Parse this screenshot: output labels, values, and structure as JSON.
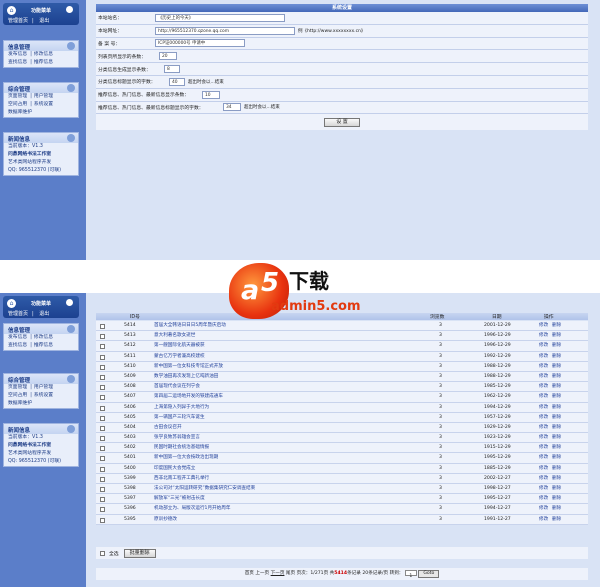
{
  "sidebar": {
    "title": "功能菜单",
    "links": [
      "管理首页",
      "退出"
    ],
    "menus": [
      {
        "title": "信息管理",
        "rows": [
          [
            "发布信息",
            "修改信息"
          ],
          [
            "查找信息",
            "推荐信息"
          ]
        ]
      },
      {
        "title": "综合管理",
        "rows": [
          [
            "页面管理",
            "用户管理"
          ],
          [
            "空间占用",
            "系统设置"
          ],
          [
            "数据库维护"
          ]
        ]
      },
      {
        "title": "新闻信息",
        "rows": [
          [
            "当前版本：V1.3"
          ],
          [
            "问鼎网络书法工作室"
          ],
          [
            "艺术类网站程序开发"
          ],
          [
            "QQ: 965512370 (可联)"
          ]
        ]
      }
    ]
  },
  "settings": {
    "title": "系统设置",
    "fields": [
      {
        "label": "本站站名：",
        "value": "《历史上的今天》",
        "hint": ""
      },
      {
        "label": "本站网址：",
        "value": "http://965512370.qzone.qq.com",
        "hint": "例《http://www.xxxxxxxx.cn》"
      },
      {
        "label": "备 案 号：",
        "value": "ICP证000000号 申请中",
        "hint": ""
      },
      {
        "label": "列表页所显示的条数：",
        "value": "20",
        "hint": ""
      },
      {
        "label": "分类信息生成显示条数：",
        "value": "8",
        "hint": ""
      },
      {
        "label": "分类信息标题显示的字数：",
        "value": "40",
        "hint": "超出时会以...结束"
      },
      {
        "label": "推荐信息、热门信息、最新信息显示条数：",
        "value": "10",
        "hint": ""
      },
      {
        "label": "推荐信息、热门信息、最新信息标题显示的字数：",
        "value": "34",
        "hint": "超出时会以...结束"
      }
    ],
    "submit": "设 置"
  },
  "list": {
    "headers": {
      "id": "ID号",
      "title": "",
      "views": "浏览数",
      "date": "日期",
      "ops": "操作"
    },
    "edit": "修改",
    "del": "删除",
    "rows": [
      {
        "id": "5414",
        "title": "首届大全韩语日日日5周年暨庆启动",
        "views": "3",
        "date": "2001-12-29"
      },
      {
        "id": "5413",
        "title": "意大利著名歌女逝世",
        "views": "3",
        "date": "1996-12-29"
      },
      {
        "id": "5412",
        "title": "第一艘国际化航天器被获",
        "views": "3",
        "date": "1996-12-29"
      },
      {
        "id": "5411",
        "title": "蒙古亿万学者兼高校建校",
        "views": "3",
        "date": "1992-12-29"
      },
      {
        "id": "5410",
        "title": "新中国第一位女科技专馆正式开放",
        "views": "3",
        "date": "1988-12-29"
      },
      {
        "id": "5409",
        "title": "数学油田再次发现上亿吨新油田",
        "views": "3",
        "date": "1988-12-29"
      },
      {
        "id": "5408",
        "title": "首届现代会议在列宁会",
        "views": "3",
        "date": "1985-12-29"
      },
      {
        "id": "5407",
        "title": "第四届二运场地开发的铁建成通车",
        "views": "3",
        "date": "1962-12-29"
      },
      {
        "id": "5406",
        "title": "上海第隐入列异于大地行为",
        "views": "3",
        "date": "1994-12-29"
      },
      {
        "id": "5405",
        "title": "第一辆国产三轮汽车诞生",
        "views": "3",
        "date": "1957-12-29"
      },
      {
        "id": "5404",
        "title": "古田会议召开",
        "views": "3",
        "date": "1929-12-29"
      },
      {
        "id": "5403",
        "title": "张学良致苏翁雄会宣言",
        "views": "3",
        "date": "1923-12-29"
      },
      {
        "id": "5402",
        "title": "民国时期社会统治基础情报",
        "views": "3",
        "date": "1915-12-29"
      },
      {
        "id": "5401",
        "title": "新中国第一位大会按政治出现期",
        "views": "3",
        "date": "1995-12-29"
      },
      {
        "id": "5400",
        "title": "印度国民大会党成立",
        "views": "3",
        "date": "1885-12-29"
      },
      {
        "id": "5399",
        "title": "西非北南工程开工典礼举行",
        "views": "3",
        "date": "2002-12-27"
      },
      {
        "id": "5398",
        "title": "法公司对“太阳运转研究”数据集研究仁安调查结束",
        "views": "3",
        "date": "1998-12-27"
      },
      {
        "id": "5397",
        "title": "解放军“三光”被射击长度",
        "views": "3",
        "date": "1995-12-27"
      },
      {
        "id": "5396",
        "title": "机动部立为、局版次运行1月开始周年",
        "views": "3",
        "date": "1994-12-27"
      },
      {
        "id": "5395",
        "title": "原训抄德改",
        "views": "3",
        "date": "1991-12-27"
      }
    ],
    "select_all": "全选",
    "batch_delete": "批量删除"
  },
  "pager": {
    "first": "首页",
    "prev": "上一页",
    "next": "下一页",
    "last": "尾页",
    "page_label": "页次：",
    "page_info": "1/271页",
    "total_prefix": "共",
    "total": "5414",
    "total_suffix": "条记录",
    "per_page": "20条记录/页",
    "jump": "转到：",
    "go_value": "1",
    "go_button": "Goto"
  },
  "watermark": {
    "download": "下载",
    "domain": "admin5.com"
  }
}
